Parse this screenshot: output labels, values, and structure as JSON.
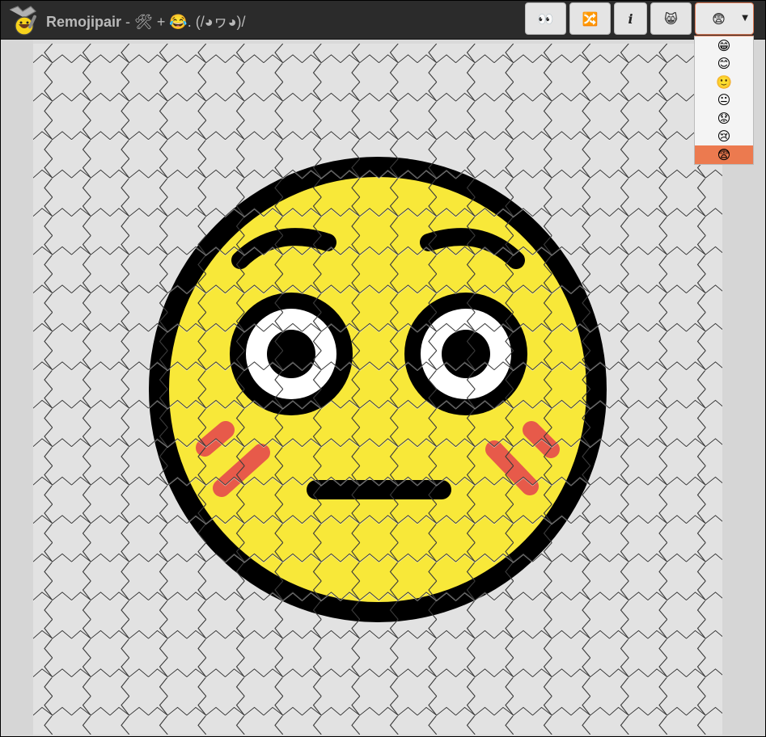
{
  "app": {
    "name": "Remojipair",
    "title_rest": " - 🛠 + 😂. (/◕ヮ◕)/"
  },
  "toolbar": {
    "buttons": [
      {
        "id": "eyes",
        "icon": "eyes-icon",
        "glyph": "👀"
      },
      {
        "id": "shuffle",
        "icon": "shuffle-icon",
        "glyph": "🔀"
      },
      {
        "id": "info",
        "icon": "info-icon",
        "glyph": "i"
      },
      {
        "id": "cat",
        "icon": "grinning-cat-icon",
        "glyph": "😸"
      },
      {
        "id": "difficulty",
        "icon": "hushed-face-icon",
        "glyph": "😨"
      }
    ]
  },
  "difficulty_options": [
    {
      "icon": "grinning-face-icon",
      "glyph": "😁",
      "selected": false
    },
    {
      "icon": "smiling-face-icon",
      "glyph": "😊",
      "selected": false
    },
    {
      "icon": "slight-smile-icon",
      "glyph": "🙂",
      "selected": false
    },
    {
      "icon": "neutral-face-icon",
      "glyph": "😐",
      "selected": false
    },
    {
      "icon": "worried-face-icon",
      "glyph": "😟",
      "selected": false
    },
    {
      "icon": "crying-face-icon",
      "glyph": "😢",
      "selected": false
    },
    {
      "icon": "fearful-face-icon",
      "glyph": "😨",
      "selected": true
    }
  ],
  "puzzle": {
    "image": "flushed-face-icon",
    "colors": {
      "face": "#f8e839",
      "outline": "#000000",
      "blush": "#e75a4a",
      "board": "#e2e2e2",
      "accent": "#ec7a4f"
    }
  }
}
